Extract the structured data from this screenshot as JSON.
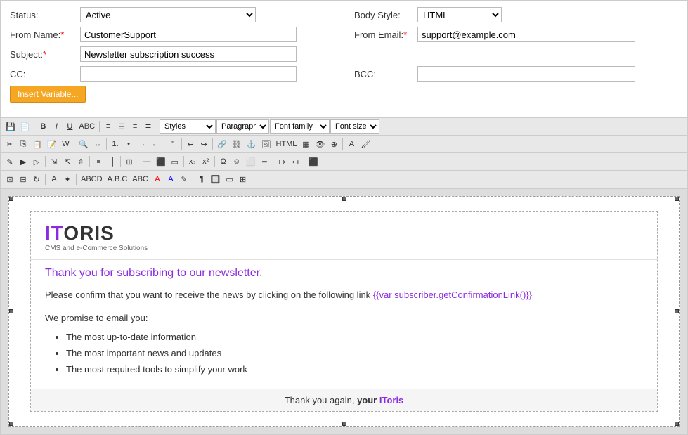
{
  "form": {
    "status_label": "Status:",
    "status_value": "Active",
    "from_name_label": "From Name:",
    "from_name_value": "CustomerSupport",
    "subject_label": "Subject:",
    "subject_value": "Newsletter subscription success",
    "cc_label": "CC:",
    "cc_value": "",
    "body_style_label": "Body Style:",
    "body_style_value": "HTML",
    "from_email_label": "From Email:",
    "from_email_value": "support@example.com",
    "bcc_label": "BCC:",
    "bcc_value": "",
    "insert_variable_btn": "Insert Variable..."
  },
  "toolbar": {
    "styles_placeholder": "Styles",
    "paragraph_placeholder": "Paragraph",
    "font_family_placeholder": "Font family",
    "font_size_placeholder": "Font size"
  },
  "email": {
    "logo_it": "IT",
    "logo_oris": "ORIS",
    "logo_subtitle": "CMS and e-Commerce Solutions",
    "thank_you_heading": "Thank you for subscribing to our newsletter.",
    "confirm_text": "Please confirm that you want to receive the news by clicking on the following link",
    "confirm_link": "{{var subscriber.getConfirmationLink()}}",
    "promise_text": "We promise to email you:",
    "list_items": [
      "The most up-to-date information",
      "The most important news and updates",
      "The most required tools to simplify your work"
    ],
    "footer_text": "Thank you again,",
    "footer_your": "your",
    "footer_brand": "IToris"
  }
}
